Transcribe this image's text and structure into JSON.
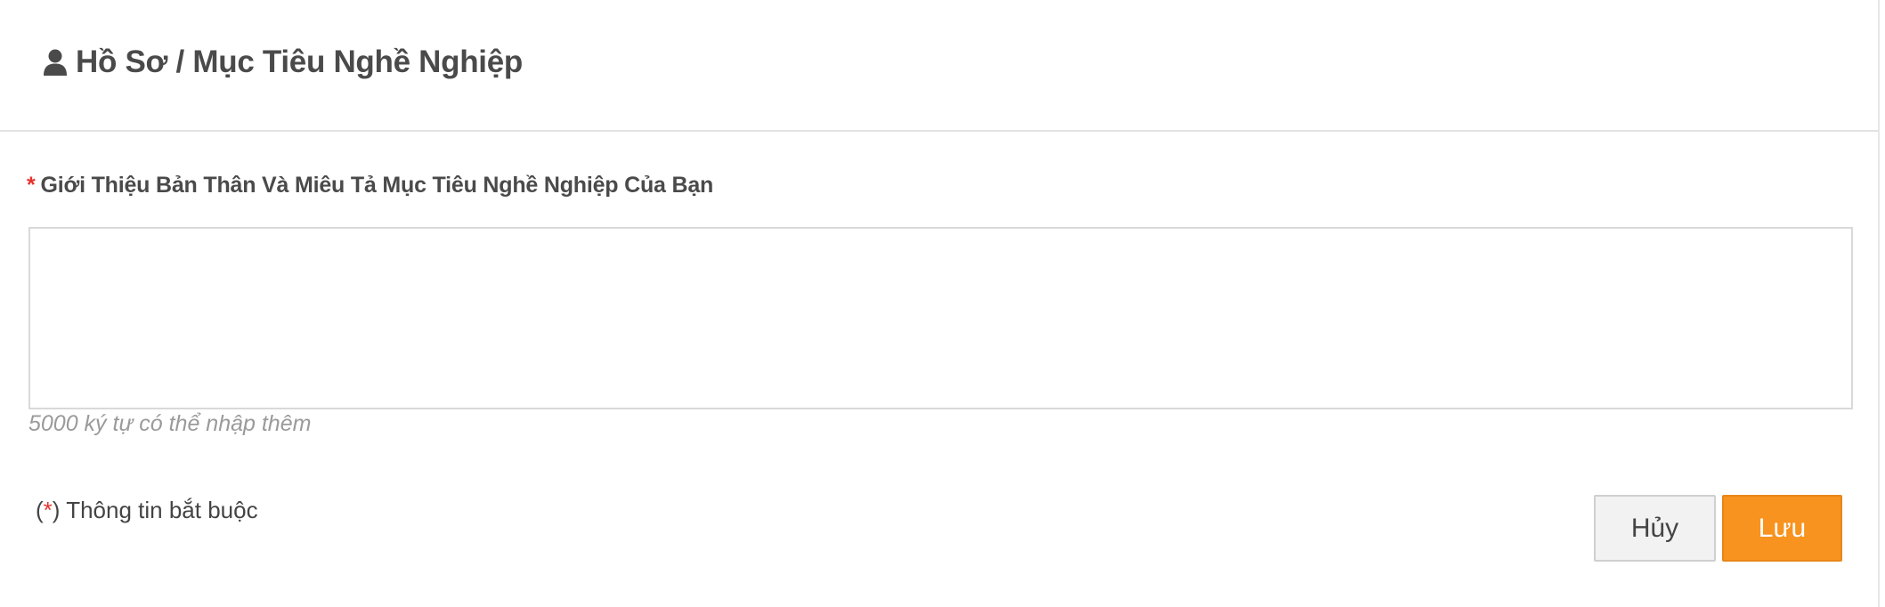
{
  "header": {
    "icon": "user-icon",
    "title": "Hồ Sơ / Mục Tiêu Nghề Nghiệp"
  },
  "form": {
    "required_mark": "*",
    "label": "Giới Thiệu Bản Thân Và Miêu Tả Mục Tiêu Nghề Nghiệp Của Bạn",
    "textarea_value": "",
    "counter_text": "5000 ký tự có thể nhập thêm"
  },
  "footer": {
    "note_open": "(",
    "note_star": "*",
    "note_close": ") Thông tin bắt buộc",
    "cancel_label": "Hủy",
    "save_label": "Lưu"
  },
  "colors": {
    "accent": "#f7931e",
    "required": "#e8322d",
    "text": "#4a4a4a",
    "muted": "#9a9a9a"
  }
}
